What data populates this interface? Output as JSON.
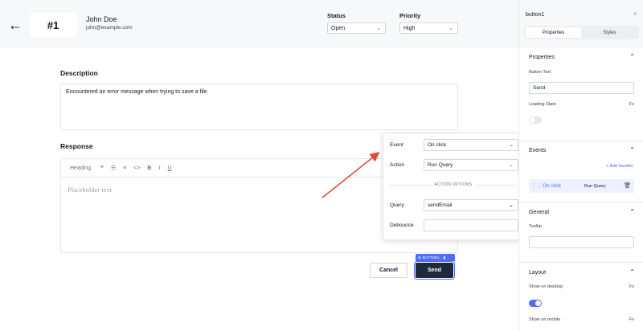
{
  "header": {
    "ticket_number": "#1",
    "user_name": "John Doe",
    "user_email": "john@example.com",
    "status_label": "Status",
    "status_value": "Open",
    "priority_label": "Priority",
    "priority_value": "High"
  },
  "description": {
    "title": "Description",
    "text": "Encountered an error message when trying to save a file."
  },
  "response": {
    "title": "Response",
    "toolbar": {
      "heading": "Heading",
      "quote": "❝",
      "bullets": "☰",
      "numbered": "≡",
      "code": "<>",
      "bold": "B",
      "italic": "I",
      "underline": "U"
    },
    "placeholder": "Placeholder text"
  },
  "popover": {
    "event_label": "Event",
    "event_value": "On click",
    "action_label": "Action",
    "action_value": "Run Query",
    "divider": "ACTION OPTIONS",
    "query_label": "Query",
    "query_value": "sendEmail",
    "debounce_label": "Debounce",
    "debounce_value": ""
  },
  "buttons": {
    "cancel": "Cancel",
    "send": "Send",
    "tag": "BUTTON1"
  },
  "panel": {
    "component_name": "button1",
    "tabs": [
      "Properties",
      "Styles"
    ],
    "properties_title": "Properties",
    "button_text_label": "Button Text",
    "button_text_value": "Send",
    "loading_state_label": "Loading State",
    "fx": "Fx",
    "events_title": "Events",
    "add_handler": "+ Add handler",
    "handler_event": "On click",
    "handler_action": "Run Query",
    "general_title": "General",
    "tooltip_label": "Tooltip",
    "tooltip_value": "",
    "layout_title": "Layout",
    "show_desktop_label": "Show on desktop",
    "show_mobile_label": "Show on mobile",
    "loading_state_on": false,
    "show_desktop_on": true
  },
  "colors": {
    "accent": "#4f6ef7",
    "send_button": "#1e293b",
    "arrow": "#e04a2f"
  }
}
